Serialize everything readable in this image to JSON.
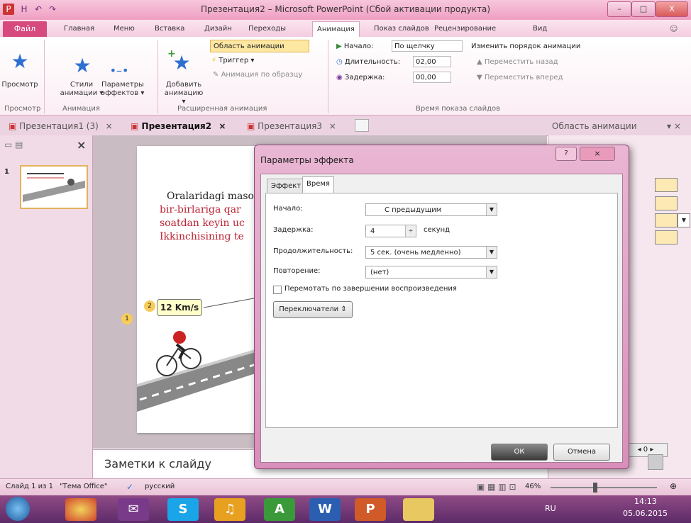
{
  "window": {
    "title": "Презентация2 – Microsoft PowerPoint (Сбой активации продукта)",
    "min_label": "–",
    "max_label": "□",
    "close_label": "X"
  },
  "quick_access": [
    "P",
    "H",
    "↶",
    "↷"
  ],
  "ribbon_tabs": {
    "file": "Файл",
    "items": [
      "Главная",
      "Меню",
      "Вставка",
      "Дизайн",
      "Переходы",
      "Анимация",
      "Показ слайдов",
      "Рецензирование",
      "Вид"
    ],
    "active": "Анимация"
  },
  "ribbon": {
    "preview_label": "Просмотр",
    "styles_label_1": "Стили",
    "styles_label_2": "анимации ▾",
    "params_label_1": "Параметры",
    "params_label_2": "эффектов ▾",
    "add_label_1": "Добавить",
    "add_label_2": "анимацию ▾",
    "area_btn": "Область анимации",
    "trigger_btn": "Триггер ▾",
    "painter_btn": "Анимация по образцу",
    "start_label": "Начало:",
    "start_value": "По щелчку",
    "duration_label": "Длительность:",
    "duration_value": "02,00",
    "delay_label": "Задержка:",
    "delay_value": "00,00",
    "reorder_label": "Изменить порядок анимации",
    "move_back": "Переместить назад",
    "move_fwd": "Переместить вперед",
    "group_preview": "Просмотр",
    "group_animation": "Анимация",
    "group_advanced": "Расширенная анимация",
    "group_timing": "Время показа слайдов"
  },
  "doc_tabs": [
    "Презентация1 (3)",
    "Презентация2",
    "Презентация3"
  ],
  "doc_tab_active": "Презентация2",
  "animation_pane_title": "Область анимации",
  "slide": {
    "thumb_number": "1",
    "lines": [
      "Oralaridagi maso",
      "bir-birlariga qar",
      "soatdan keyin uc",
      "Ikkinchisining te"
    ],
    "badge_text": "12 Km/s",
    "anim_marker_1": "2",
    "anim_marker_2": "1"
  },
  "notes_placeholder": "Заметки к слайду",
  "dialog": {
    "title": "Параметры эффекта",
    "tabs": [
      "Эффект",
      "Время"
    ],
    "active_tab": "Время",
    "start_label": "Начало:",
    "start_value": "С предыдущим",
    "delay_label": "Задержка:",
    "delay_value": "4",
    "delay_unit": "секунд",
    "duration_label": "Продолжительность:",
    "duration_value": "5 сек. (очень медленно)",
    "repeat_label": "Повторение:",
    "repeat_value": "(нет)",
    "rewind_label": "Перемотать по завершении воспроизведения",
    "triggers_btn": "Переключатели",
    "ok_btn": "ОК",
    "cancel_btn": "Отмена"
  },
  "status": {
    "slide_info": "Слайд 1 из 1",
    "theme": "\"Тема Office\"",
    "language": "русский",
    "zoom": "46%"
  },
  "taskbar": {
    "lang": "RU",
    "time": "14:13",
    "date": "05.06.2015",
    "apps": [
      "chrome",
      "mail",
      "skype",
      "music",
      "maps",
      "word",
      "powerpoint",
      "explorer"
    ]
  }
}
